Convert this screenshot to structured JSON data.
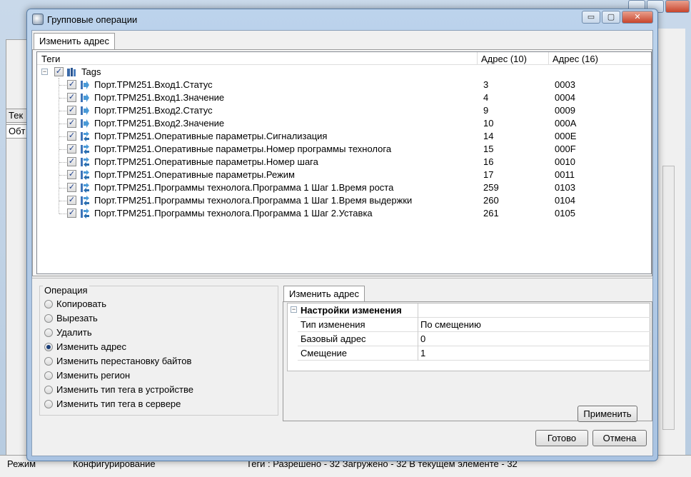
{
  "background": {
    "left_strip_label": "Тек",
    "left_tab_label": "Обт",
    "status": {
      "mode_label": "Режим",
      "mode_value": "Конфигурирование",
      "tags_summary": "Теги : Разрешено - 32 Загружено - 32 В текущем элементе - 32"
    }
  },
  "dialog": {
    "title": "Групповые операции",
    "title_buttons": {
      "minimize": "▭",
      "maximize": "▢",
      "close": "✕"
    },
    "top_tab": "Изменить адрес",
    "grid": {
      "headers": {
        "tags": "Теги",
        "addr10": "Адрес (10)",
        "addr16": "Адрес (16)"
      },
      "root": {
        "label": "Tags",
        "expander": "−",
        "checked": "✓"
      },
      "rows": [
        {
          "name": "Порт.ТРМ251.Вход1.Статус",
          "addr10": "3",
          "addr16": "0003",
          "icon": "arrow-right-icon"
        },
        {
          "name": "Порт.ТРМ251.Вход1.Значение",
          "addr10": "4",
          "addr16": "0004",
          "icon": "arrow-right-icon"
        },
        {
          "name": "Порт.ТРМ251.Вход2.Статус",
          "addr10": "9",
          "addr16": "0009",
          "icon": "arrow-right-icon"
        },
        {
          "name": "Порт.ТРМ251.Вход2.Значение",
          "addr10": "10",
          "addr16": "000A",
          "icon": "arrow-right-icon"
        },
        {
          "name": "Порт.ТРМ251.Оперативные параметры.Сигнализация",
          "addr10": "14",
          "addr16": "000E",
          "icon": "arrow-bidirectional-icon"
        },
        {
          "name": "Порт.ТРМ251.Оперативные параметры.Номер программы технолога",
          "addr10": "15",
          "addr16": "000F",
          "icon": "arrow-bidirectional-icon"
        },
        {
          "name": "Порт.ТРМ251.Оперативные параметры.Номер шага",
          "addr10": "16",
          "addr16": "0010",
          "icon": "arrow-bidirectional-icon"
        },
        {
          "name": "Порт.ТРМ251.Оперативные параметры.Режим",
          "addr10": "17",
          "addr16": "0011",
          "icon": "arrow-bidirectional-icon"
        },
        {
          "name": "Порт.ТРМ251.Программы технолога.Программа 1 Шаг 1.Время роста",
          "addr10": "259",
          "addr16": "0103",
          "icon": "arrow-bidirectional-icon"
        },
        {
          "name": "Порт.ТРМ251.Программы технолога.Программа 1 Шаг 1.Время выдержки",
          "addr10": "260",
          "addr16": "0104",
          "icon": "arrow-bidirectional-icon"
        },
        {
          "name": "Порт.ТРМ251.Программы технолога.Программа 1 Шаг 2.Уставка",
          "addr10": "261",
          "addr16": "0105",
          "icon": "arrow-bidirectional-icon"
        }
      ]
    },
    "operation": {
      "title": "Операция",
      "options": [
        {
          "label": "Копировать",
          "selected": false
        },
        {
          "label": "Вырезать",
          "selected": false
        },
        {
          "label": "Удалить",
          "selected": false
        },
        {
          "label": "Изменить адрес",
          "selected": true
        },
        {
          "label": "Изменить перестановку байтов",
          "selected": false
        },
        {
          "label": "Изменить регион",
          "selected": false
        },
        {
          "label": "Изменить тип тега в устройстве",
          "selected": false
        },
        {
          "label": "Изменить тип тега в сервере",
          "selected": false
        }
      ]
    },
    "change_panel": {
      "tab": "Изменить адрес",
      "section_title": "Настройки изменения",
      "section_expander": "−",
      "props": [
        {
          "key": "Тип изменения",
          "value": "По смещению"
        },
        {
          "key": "Базовый адрес",
          "value": "0"
        },
        {
          "key": "Смещение",
          "value": "1"
        }
      ],
      "apply_label": "Применить"
    },
    "ok_label": "Готово",
    "cancel_label": "Отмена"
  }
}
